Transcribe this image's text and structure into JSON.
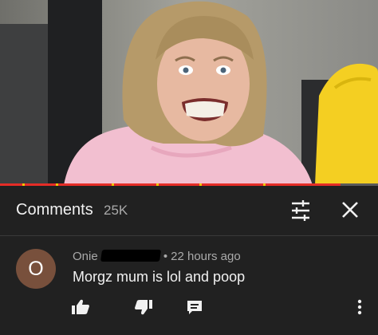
{
  "header": {
    "title": "Comments",
    "count": "25K",
    "sort_icon": "sort-sliders-icon",
    "close_icon": "close-icon"
  },
  "video": {
    "progress": 0.9
  },
  "comment": {
    "avatar_letter": "O",
    "author": "Onie",
    "separator": "•",
    "time": "22 hours ago",
    "text": "Morgz mum is lol and poop",
    "avatar_color": "#78503c"
  },
  "colors": {
    "background": "#212121",
    "text_primary": "#f1f1f1",
    "text_secondary": "#aaaaaa",
    "progress": "#e52d27"
  }
}
